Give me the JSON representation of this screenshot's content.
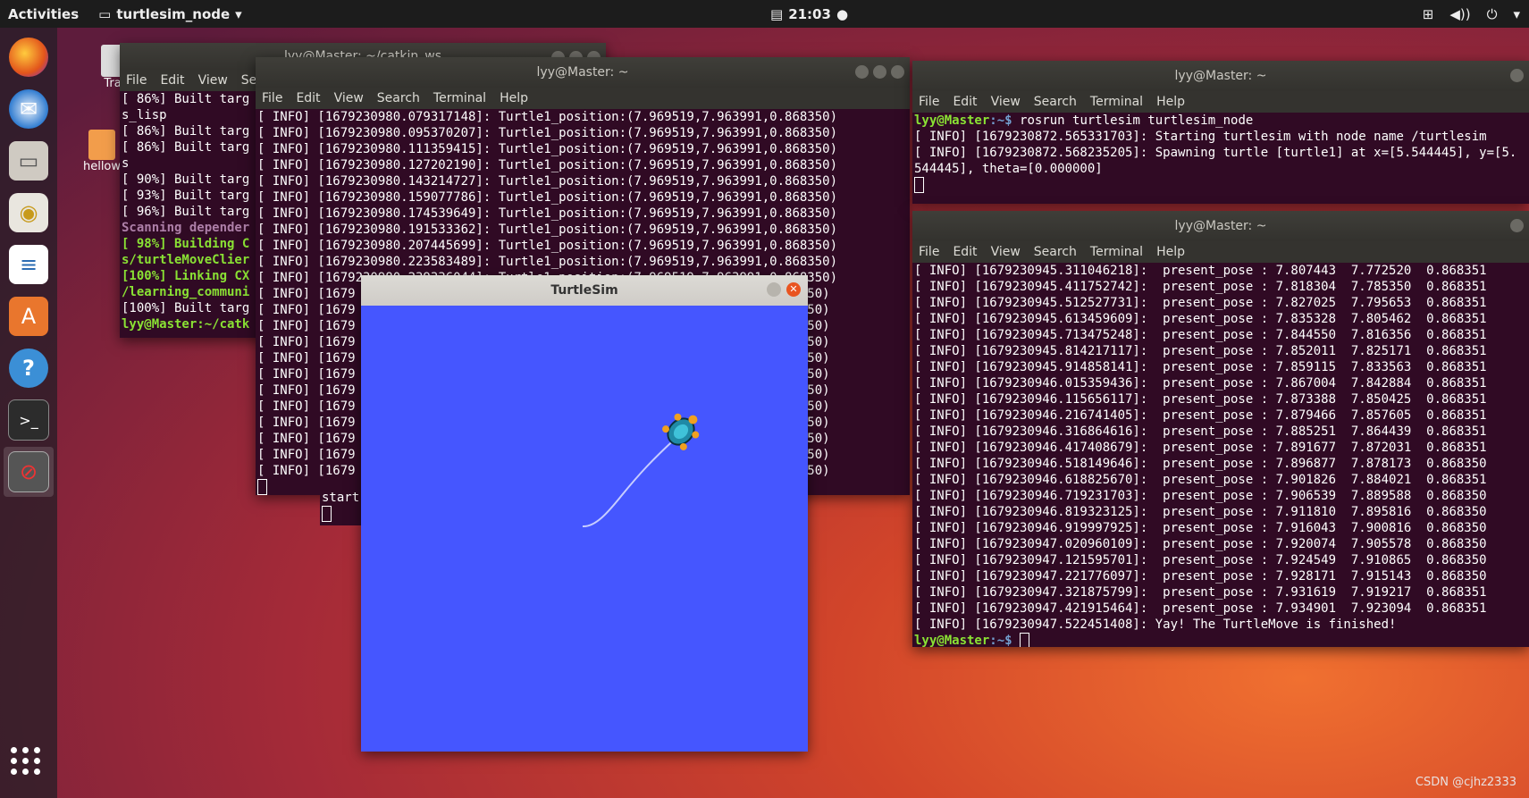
{
  "topbar": {
    "activities": "Activities",
    "app_menu": "turtlesim_node",
    "clock": "21:03"
  },
  "desktop_icons": [
    {
      "label": "Tra"
    },
    {
      "label": "hellow"
    }
  ],
  "menu_items": [
    "File",
    "Edit",
    "View",
    "Search",
    "Terminal",
    "Help"
  ],
  "win_back": {
    "title": "lyy@Master: ~/catkin_ws",
    "menu": [
      "File",
      "Edit",
      "View",
      "Sea"
    ],
    "lines": [
      "[ 86%] Built targ",
      "s_lisp",
      "[ 86%] Built targ",
      "[ 86%] Built targ",
      "s",
      "[ 90%] Built targ",
      "[ 93%] Built targ",
      "[ 96%] Built targ",
      "Scanning depender",
      "[ 98%] Building C",
      "s/turtleMoveClier",
      "[100%] Linking CX",
      "/learning_communi",
      "[100%] Built targ",
      "lyy@Master:~/catk"
    ]
  },
  "win_mid": {
    "title": "lyy@Master: ~",
    "lines": [
      "[ INFO] [1679230980.079317148]: Turtle1_position:(7.969519,7.963991,0.868350)",
      "[ INFO] [1679230980.095370207]: Turtle1_position:(7.969519,7.963991,0.868350)",
      "[ INFO] [1679230980.111359415]: Turtle1_position:(7.969519,7.963991,0.868350)",
      "[ INFO] [1679230980.127202190]: Turtle1_position:(7.969519,7.963991,0.868350)",
      "[ INFO] [1679230980.143214727]: Turtle1_position:(7.969519,7.963991,0.868350)",
      "[ INFO] [1679230980.159077786]: Turtle1_position:(7.969519,7.963991,0.868350)",
      "[ INFO] [1679230980.174539649]: Turtle1_position:(7.969519,7.963991,0.868350)",
      "[ INFO] [1679230980.191533362]: Turtle1_position:(7.969519,7.963991,0.868350)",
      "[ INFO] [1679230980.207445699]: Turtle1_position:(7.969519,7.963991,0.868350)",
      "[ INFO] [1679230980.223583489]: Turtle1_position:(7.969519,7.963991,0.868350)",
      "[ INFO] [1679230980.239336044]: Turtle1_position:(7.969519,7.963991,0.868350)",
      "[ INFO] [1679                                                       .868350)",
      "[ INFO] [1679                                                       .868350)",
      "[ INFO] [1679                                                       .868350)",
      "[ INFO] [1679                                                       .868350)",
      "[ INFO] [1679                                                       .868350)",
      "[ INFO] [1679                                                       .868350)",
      "[ INFO] [1679                                                       .868350)",
      "[ INFO] [1679                                                       .868350)",
      "[ INFO] [1679                                                       .868350)",
      "[ INFO] [1679                                                       .868350)",
      "[ INFO] [1679                                                       .868350)",
      "[ INFO] [1679                                                       .868350)"
    ],
    "under_text": "start"
  },
  "win_right_top": {
    "title": "lyy@Master: ~",
    "prompt": "lyy@Master",
    "prompt_path": ":~$ ",
    "command": "rosrun turtlesim turtlesim_node",
    "lines": [
      "[ INFO] [1679230872.565331703]: Starting turtlesim with node name /turtlesim",
      "[ INFO] [1679230872.568235205]: Spawning turtle [turtle1] at x=[5.544445], y=[5.",
      "544445], theta=[0.000000]"
    ]
  },
  "win_right_bottom": {
    "title": "lyy@Master: ~",
    "lines": [
      "[ INFO] [1679230945.311046218]:  present_pose : 7.807443  7.772520  0.868351",
      "[ INFO] [1679230945.411752742]:  present_pose : 7.818304  7.785350  0.868351",
      "[ INFO] [1679230945.512527731]:  present_pose : 7.827025  7.795653  0.868351",
      "[ INFO] [1679230945.613459609]:  present_pose : 7.835328  7.805462  0.868351",
      "[ INFO] [1679230945.713475248]:  present_pose : 7.844550  7.816356  0.868351",
      "[ INFO] [1679230945.814217117]:  present_pose : 7.852011  7.825171  0.868351",
      "[ INFO] [1679230945.914858141]:  present_pose : 7.859115  7.833563  0.868351",
      "[ INFO] [1679230946.015359436]:  present_pose : 7.867004  7.842884  0.868351",
      "[ INFO] [1679230946.115656117]:  present_pose : 7.873388  7.850425  0.868351",
      "[ INFO] [1679230946.216741405]:  present_pose : 7.879466  7.857605  0.868351",
      "[ INFO] [1679230946.316864616]:  present_pose : 7.885251  7.864439  0.868351",
      "[ INFO] [1679230946.417408679]:  present_pose : 7.891677  7.872031  0.868351",
      "[ INFO] [1679230946.518149646]:  present_pose : 7.896877  7.878173  0.868350",
      "[ INFO] [1679230946.618825670]:  present_pose : 7.901826  7.884021  0.868351",
      "[ INFO] [1679230946.719231703]:  present_pose : 7.906539  7.889588  0.868350",
      "[ INFO] [1679230946.819323125]:  present_pose : 7.911810  7.895816  0.868350",
      "[ INFO] [1679230946.919997925]:  present_pose : 7.916043  7.900816  0.868350",
      "[ INFO] [1679230947.020960109]:  present_pose : 7.920074  7.905578  0.868350",
      "[ INFO] [1679230947.121595701]:  present_pose : 7.924549  7.910865  0.868350",
      "[ INFO] [1679230947.221776097]:  present_pose : 7.928171  7.915143  0.868350",
      "[ INFO] [1679230947.321875799]:  present_pose : 7.931619  7.919217  0.868351",
      "[ INFO] [1679230947.421915464]:  present_pose : 7.934901  7.923094  0.868351",
      "[ INFO] [1679230947.522451408]: Yay! The TurtleMove is finished!"
    ],
    "prompt": "lyy@Master",
    "prompt_path": ":~$ "
  },
  "turtlesim": {
    "title": "TurtleSim",
    "background": "#4556ff"
  },
  "watermark": "CSDN @cjhz2333"
}
